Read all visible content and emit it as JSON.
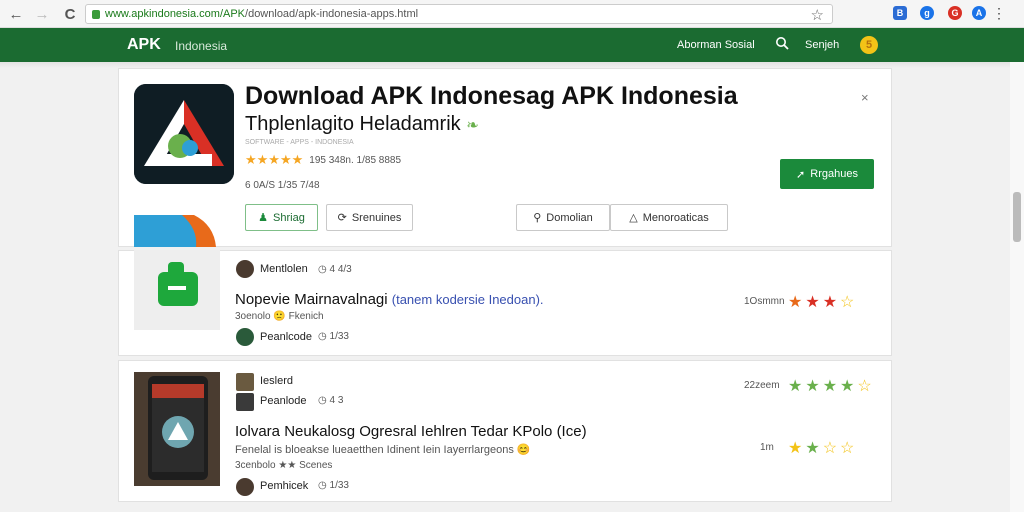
{
  "browser": {
    "url_host": "www.apkindonesia.com/APK",
    "url_path": "/download/apk-indonesia-apps.html",
    "back": "←",
    "forward": "→",
    "reload": "C",
    "bookmark": "☆",
    "menu": "⋮",
    "extensions": [
      {
        "label": "B",
        "color": "#2b6cd4"
      },
      {
        "label": "g",
        "color": "#1a73e8"
      },
      {
        "label": "G",
        "color": "#d93025"
      },
      {
        "label": "A",
        "color": "#1a73e8"
      }
    ]
  },
  "header": {
    "logo": "APK",
    "tagline": "Indonesia",
    "nav_link": "Aborman Sosial",
    "search_icon": "search-icon",
    "signin": "Senjeh",
    "coin": "5"
  },
  "app": {
    "title": "Download APK Indonesag APK Indonesia",
    "developer": "Thplenlagito Heladamrik",
    "tiny": "SOFTWARE - APPS - INDONESIA",
    "stars": "★★★★★",
    "rating_text": "195 348n. 1/85   8885",
    "meta": "6 0A/S 1/35 7/48",
    "buttons": {
      "share": "Shriag",
      "versions": "Srenuines",
      "download": "Domolian",
      "more": "Menoroaticas",
      "register": "Rrgahues"
    },
    "close": "×"
  },
  "reviews": [
    {
      "name": "Mentlolen",
      "name_meta": "◷ 4 4/3",
      "title": "Nopevie Mairnavalnagi",
      "title_link": "(tanem kodersie Inedoan).",
      "desc": "3oenolo 🙁 Fkenich",
      "poster": "Peanlcode",
      "poster_meta": "◷ 1/33",
      "rating_text": "1Osmmn",
      "stars": [
        "★",
        "★",
        "★",
        "☆"
      ],
      "star_colors": [
        "#e86a1a",
        "#d93025",
        "#d93025",
        "#f3c317"
      ]
    },
    {
      "name": "Ieslerd",
      "name2": "Peanlode",
      "name2_meta": "◷ 4 3",
      "title": "Iolvara Neukalosg Ogresral Iehlren Tedar KPolo (Ice)",
      "desc": "Fenelal is bloeakse lueaetthen Idinent Iein Iayerrlargeons 😊",
      "sub": "3cenbolo ★★ Scenes",
      "poster": "Pemhicek",
      "poster_meta": "◷ 1/33",
      "rating_text": "22zeem",
      "rating_text2": "1m",
      "stars": [
        "★",
        "★",
        "★",
        "★",
        "☆"
      ],
      "stars2": [
        "★",
        "★",
        "☆",
        "☆"
      ]
    }
  ]
}
